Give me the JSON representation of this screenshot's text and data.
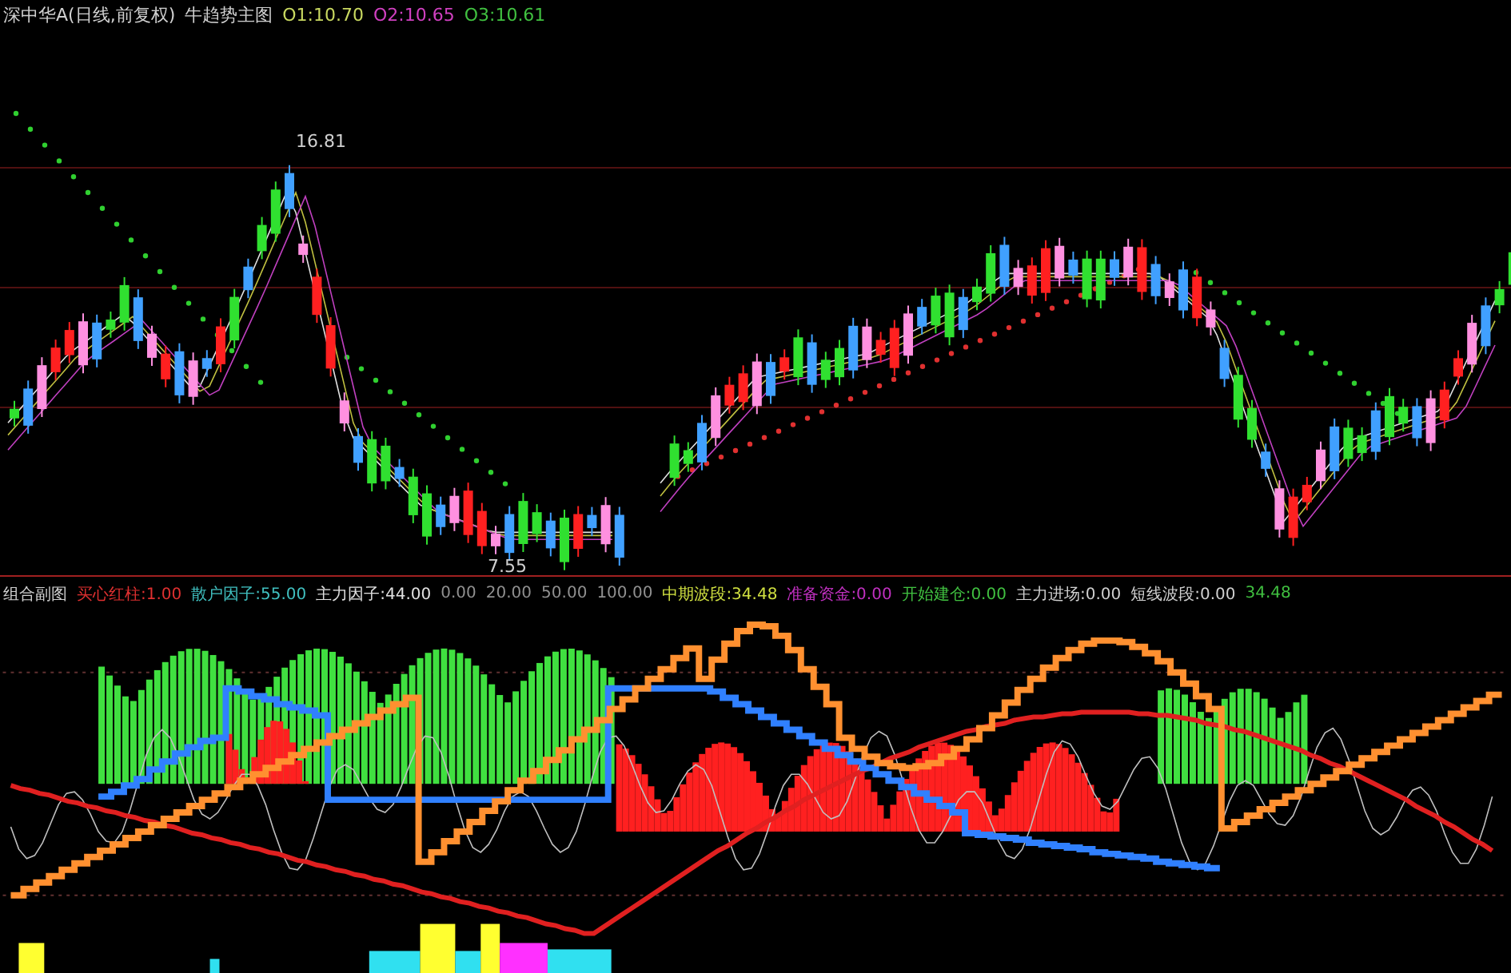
{
  "header": {
    "title": "深中华A(日线,前复权)",
    "indicator": "牛趋势主图",
    "values": [
      {
        "label": "O1:10.70",
        "color": "#c8d860"
      },
      {
        "label": "O2:10.65",
        "color": "#d040c0"
      },
      {
        "label": "O3:10.61",
        "color": "#40c040"
      }
    ]
  },
  "price_labels": [
    {
      "text": "16.81",
      "kind": "high"
    },
    {
      "text": "7.55",
      "kind": "low"
    }
  ],
  "indicator_bar": {
    "title": "组合副图",
    "items": [
      {
        "label": "买心红柱:",
        "value": "1.00",
        "color": "#e03030"
      },
      {
        "label": "散户因子:",
        "value": "55.00",
        "color": "#40c0c0"
      },
      {
        "label": "主力因子:",
        "value": "44.00",
        "color": "#e0e0e0"
      },
      {
        "value": "0.00",
        "color": "#909090"
      },
      {
        "value": "20.00",
        "color": "#909090"
      },
      {
        "value": "50.00",
        "color": "#909090"
      },
      {
        "value": "100.00",
        "color": "#909090"
      },
      {
        "label": "中期波段:",
        "value": "34.48",
        "color": "#d0e040"
      },
      {
        "label": "准备资金:",
        "value": "0.00",
        "color": "#c030c0"
      },
      {
        "label": "开始建仓:",
        "value": "0.00",
        "color": "#40c040"
      },
      {
        "label": "主力进场:",
        "value": "0.00",
        "color": "#d0d0d0"
      },
      {
        "label": "短线波段:",
        "value": "0.00",
        "color": "#d0d0d0"
      },
      {
        "value": "34.48",
        "color": "#40c040"
      }
    ]
  }
}
